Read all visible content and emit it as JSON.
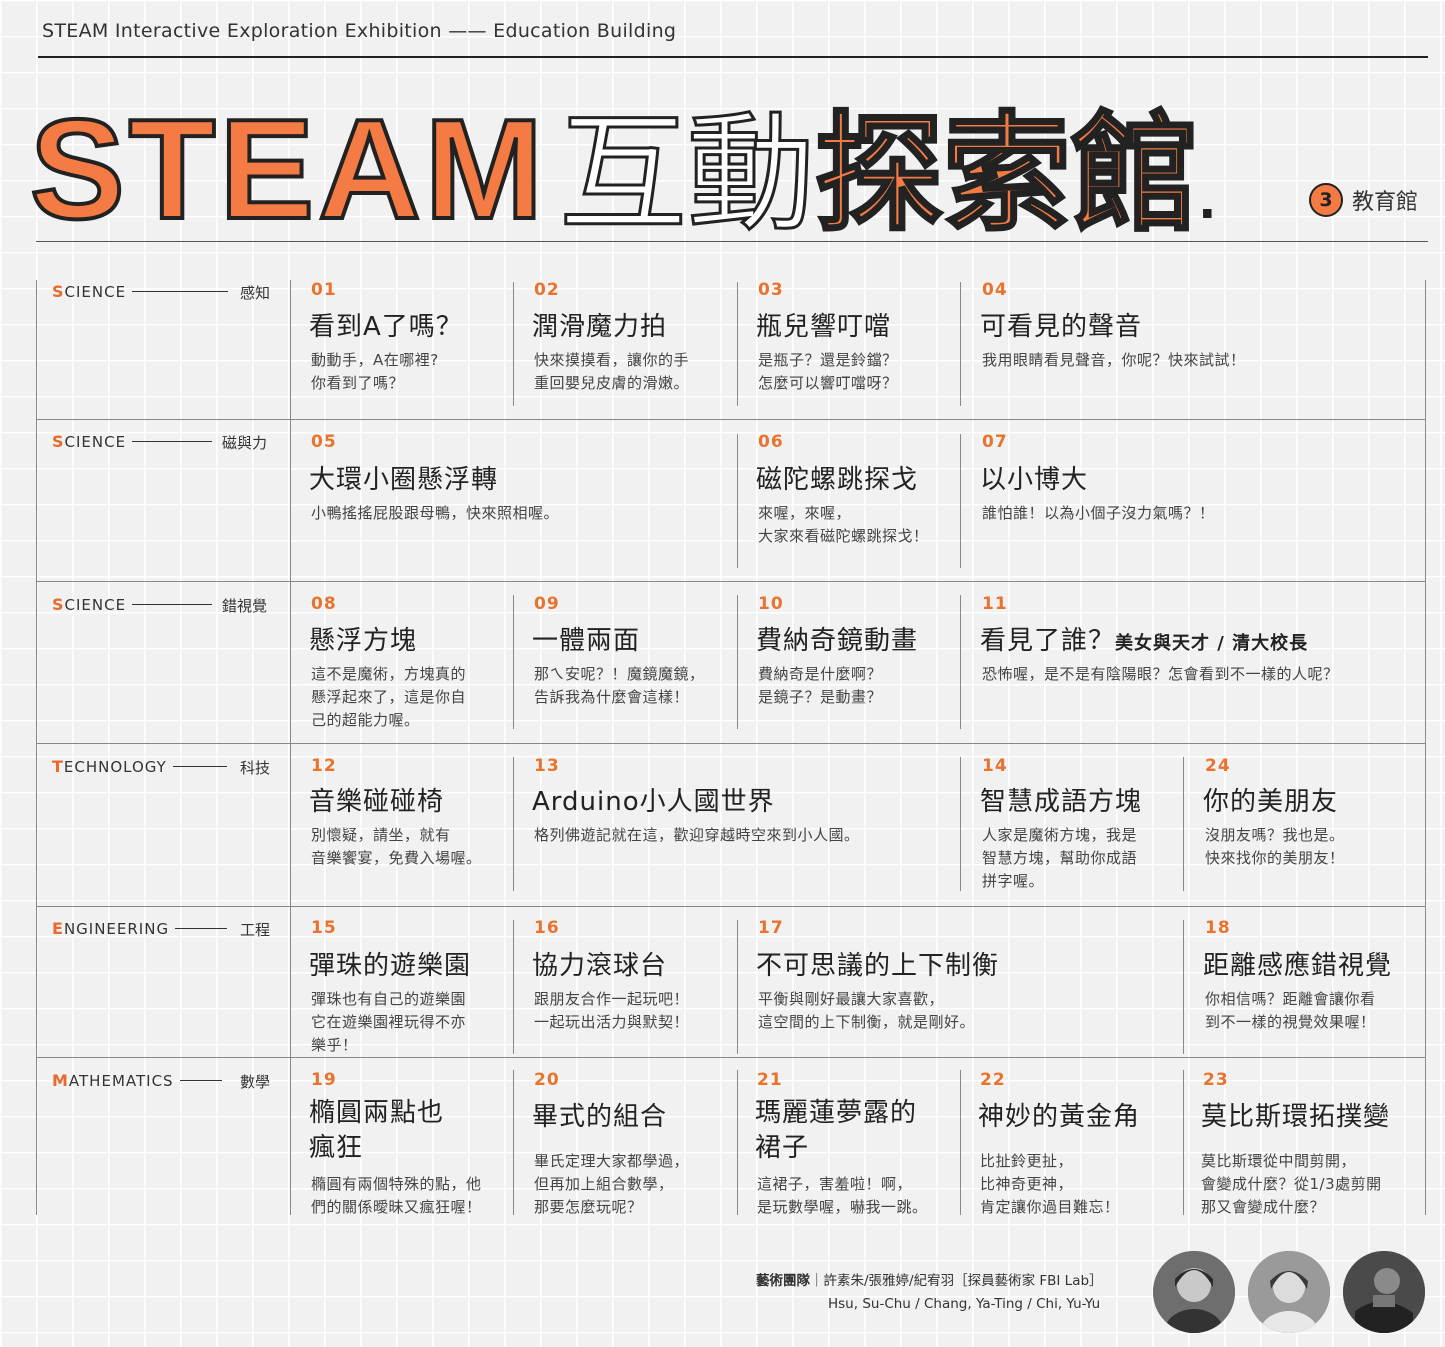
{
  "header": {
    "subtitle": "STEAM Interactive Exploration Exhibition —— Education Building",
    "title_steam": "STEAM",
    "title_hudong": "互動",
    "title_tansuo": "探索館",
    "title_dot": ".",
    "hall_number": "3",
    "hall_name": "教育館"
  },
  "rows": [
    {
      "category_initial": "S",
      "category_rest": "CIENCE",
      "category_zh": "感知"
    },
    {
      "category_initial": "S",
      "category_rest": "CIENCE",
      "category_zh": "磁與力"
    },
    {
      "category_initial": "S",
      "category_rest": "CIENCE",
      "category_zh": "錯視覺"
    },
    {
      "category_initial": "T",
      "category_rest": "ECHNOLOGY",
      "category_zh": "科技"
    },
    {
      "category_initial": "E",
      "category_rest": "NGINEERING",
      "category_zh": "工程"
    },
    {
      "category_initial": "M",
      "category_rest": "ATHEMATICS",
      "category_zh": "數學"
    }
  ],
  "exhibits": {
    "e01": {
      "num": "01",
      "title": "看到A了嗎？",
      "desc": "動動手，A在哪裡?\n你看到了嗎？"
    },
    "e02": {
      "num": "02",
      "title": "潤滑魔力拍",
      "desc": "快來摸摸看，讓你的手\n重回嬰兒皮膚的滑嫩。"
    },
    "e03": {
      "num": "03",
      "title": "瓶兒響叮噹",
      "desc": "是瓶子？還是鈴鐺？\n怎麼可以響叮噹呀？"
    },
    "e04": {
      "num": "04",
      "title": "可看見的聲音",
      "desc": "我用眼睛看見聲音，你呢？快來試試！"
    },
    "e05": {
      "num": "05",
      "title": "大環小圈懸浮轉",
      "desc": "小鴨搖搖屁股跟母鴨，快來照相喔。"
    },
    "e06": {
      "num": "06",
      "title": "磁陀螺跳探戈",
      "desc": "來喔，來喔，\n大家來看磁陀螺跳探戈！"
    },
    "e07": {
      "num": "07",
      "title": "以小博大",
      "desc": "誰怕誰！以為小個子沒力氣嗎？！"
    },
    "e08": {
      "num": "08",
      "title": "懸浮方塊",
      "desc": "這不是魔術，方塊真的\n懸浮起來了，這是你自\n己的超能力喔。"
    },
    "e09": {
      "num": "09",
      "title": "一體兩面",
      "desc": "那ㄟ安呢？！魔鏡魔鏡，\n告訴我為什麼會這樣！"
    },
    "e10": {
      "num": "10",
      "title": "費納奇鏡動畫",
      "desc": "費納奇是什麼啊？\n是鏡子？是動畫？"
    },
    "e11": {
      "num": "11",
      "title": "看見了誰？",
      "title_note": "美女與天才 / 清大校長",
      "desc": "恐怖喔，是不是有陰陽眼？怎會看到不一樣的人呢？"
    },
    "e12": {
      "num": "12",
      "title": "音樂碰碰椅",
      "desc": "別懷疑，請坐，就有\n音樂饗宴，免費入場喔。"
    },
    "e13": {
      "num": "13",
      "title": "Arduino小人國世界",
      "desc": "格列佛遊記就在這，歡迎穿越時空來到小人國。"
    },
    "e14": {
      "num": "14",
      "title": "智慧成語方塊",
      "desc": "人家是魔術方塊，我是\n智慧方塊，幫助你成語\n拼字喔。"
    },
    "e24": {
      "num": "24",
      "title": "你的美朋友",
      "desc": "沒朋友嗎？我也是。\n快來找你的美朋友！"
    },
    "e15": {
      "num": "15",
      "title": "彈珠的遊樂園",
      "desc": "彈珠也有自己的遊樂園\n它在遊樂園裡玩得不亦\n樂乎！"
    },
    "e16": {
      "num": "16",
      "title": "協力滾球台",
      "desc": "跟朋友合作一起玩吧！\n一起玩出活力與默契！"
    },
    "e17": {
      "num": "17",
      "title": "不可思議的上下制衡",
      "desc": "平衡與剛好最讓大家喜歡，\n這空間的上下制衡，就是剛好。"
    },
    "e18": {
      "num": "18",
      "title": "距離感應錯視覺",
      "desc": "你相信嗎？距離會讓你看\n到不一樣的視覺效果喔！"
    },
    "e19": {
      "num": "19",
      "title": "橢圓兩點也\n瘋狂",
      "desc": "橢圓有兩個特殊的點，他\n們的關係曖昧又瘋狂喔！"
    },
    "e20": {
      "num": "20",
      "title": "畢式的組合",
      "desc": "畢氏定理大家都學過，\n但再加上組合數學，\n那要怎麼玩呢？"
    },
    "e21": {
      "num": "21",
      "title": "瑪麗蓮夢露的\n裙子",
      "desc": "這裙子，害羞啦！啊，\n是玩數學喔，嚇我一跳。"
    },
    "e22": {
      "num": "22",
      "title": "神妙的黃金角",
      "desc": "比扯鈴更扯，\n比神奇更神，\n肯定讓你過目難忘！"
    },
    "e23": {
      "num": "23",
      "title": "莫比斯環拓撲變",
      "desc": "莫比斯環從中間剪開，\n會變成什麼？從1/3處剪開\n那又會變成什麼？"
    }
  },
  "credits": {
    "label": "藝術團隊",
    "names_zh": "｜許素朱/張雅婷/紀宥羽［探員藝術家 FBI Lab］",
    "names_en": "Hsu, Su-Chu / Chang, Ya-Ting / Chi, Yu-Yu"
  },
  "colors": {
    "accent": "#f47c44",
    "text": "#222222",
    "background": "#f1f1f1"
  }
}
